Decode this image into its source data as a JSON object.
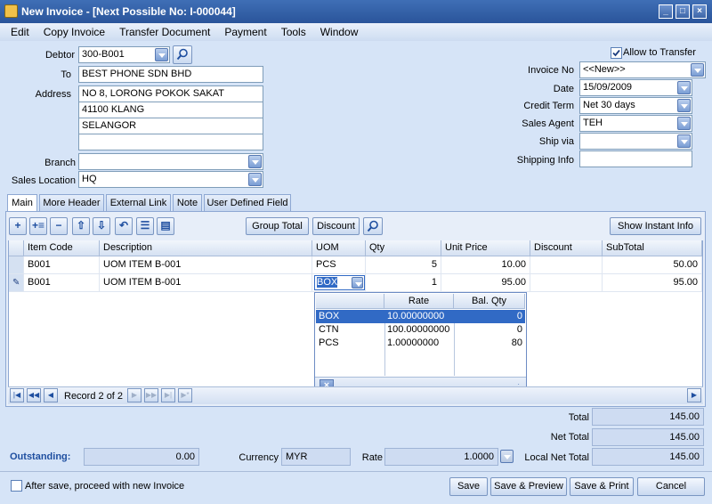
{
  "window": {
    "title": "New Invoice - [Next Possible No: I-000044]"
  },
  "menu": [
    "Edit",
    "Copy Invoice",
    "Transfer Document",
    "Payment",
    "Tools",
    "Window"
  ],
  "header": {
    "debtor_label": "Debtor",
    "debtor_value": "300-B001",
    "to_label": "To",
    "to_value": "BEST PHONE SDN BHD",
    "address_label": "Address",
    "address_lines": [
      "NO 8, LORONG POKOK SAKAT",
      "41100 KLANG",
      "SELANGOR",
      ""
    ],
    "branch_label": "Branch",
    "branch_value": "",
    "sales_location_label": "Sales Location",
    "sales_location_value": "HQ",
    "allow_transfer_label": "Allow to Transfer",
    "invoice_no_label": "Invoice No",
    "invoice_no_value": "<<New>>",
    "date_label": "Date",
    "date_value": "15/09/2009",
    "credit_term_label": "Credit Term",
    "credit_term_value": "Net 30 days",
    "sales_agent_label": "Sales Agent",
    "sales_agent_value": "TEH",
    "ship_via_label": "Ship via",
    "ship_via_value": "",
    "shipping_info_label": "Shipping Info",
    "shipping_info_value": ""
  },
  "tabs": [
    "Main",
    "More Header",
    "External Link",
    "Note",
    "User Defined Field"
  ],
  "toolbar": {
    "group_total": "Group Total",
    "discount": "Discount",
    "show_instant_info": "Show Instant Info"
  },
  "grid": {
    "columns": [
      "Item Code",
      "Description",
      "UOM",
      "Qty",
      "Unit Price",
      "Discount",
      "SubTotal"
    ],
    "rows": [
      {
        "item_code": "B001",
        "description": "UOM ITEM B-001",
        "uom": "PCS",
        "qty": "5",
        "unit_price": "10.00",
        "discount": "",
        "subtotal": "50.00"
      },
      {
        "item_code": "B001",
        "description": "UOM ITEM B-001",
        "uom": "BOX",
        "qty": "1",
        "unit_price": "95.00",
        "discount": "",
        "subtotal": "95.00"
      }
    ]
  },
  "uom_popup": {
    "columns": [
      "",
      "Rate",
      "Bal. Qty"
    ],
    "rows": [
      {
        "uom": "BOX",
        "rate": "10.00000000",
        "bal_qty": "0"
      },
      {
        "uom": "CTN",
        "rate": "100.00000000",
        "bal_qty": "0"
      },
      {
        "uom": "PCS",
        "rate": "1.00000000",
        "bal_qty": "80"
      }
    ]
  },
  "navigator": {
    "record_text": "Record 2 of 2"
  },
  "footer": {
    "total_label": "Total",
    "total_value": "145.00",
    "net_total_label": "Net Total",
    "net_total_value": "145.00",
    "outstanding_label": "Outstanding:",
    "outstanding_value": "0.00",
    "currency_label": "Currency",
    "currency_value": "MYR",
    "rate_label": "Rate",
    "rate_value": "1.0000",
    "local_net_total_label": "Local Net Total",
    "local_net_total_value": "145.00",
    "after_save_label": "After save, proceed with new Invoice",
    "save": "Save",
    "save_preview": "Save & Preview",
    "save_print": "Save & Print",
    "cancel": "Cancel"
  }
}
